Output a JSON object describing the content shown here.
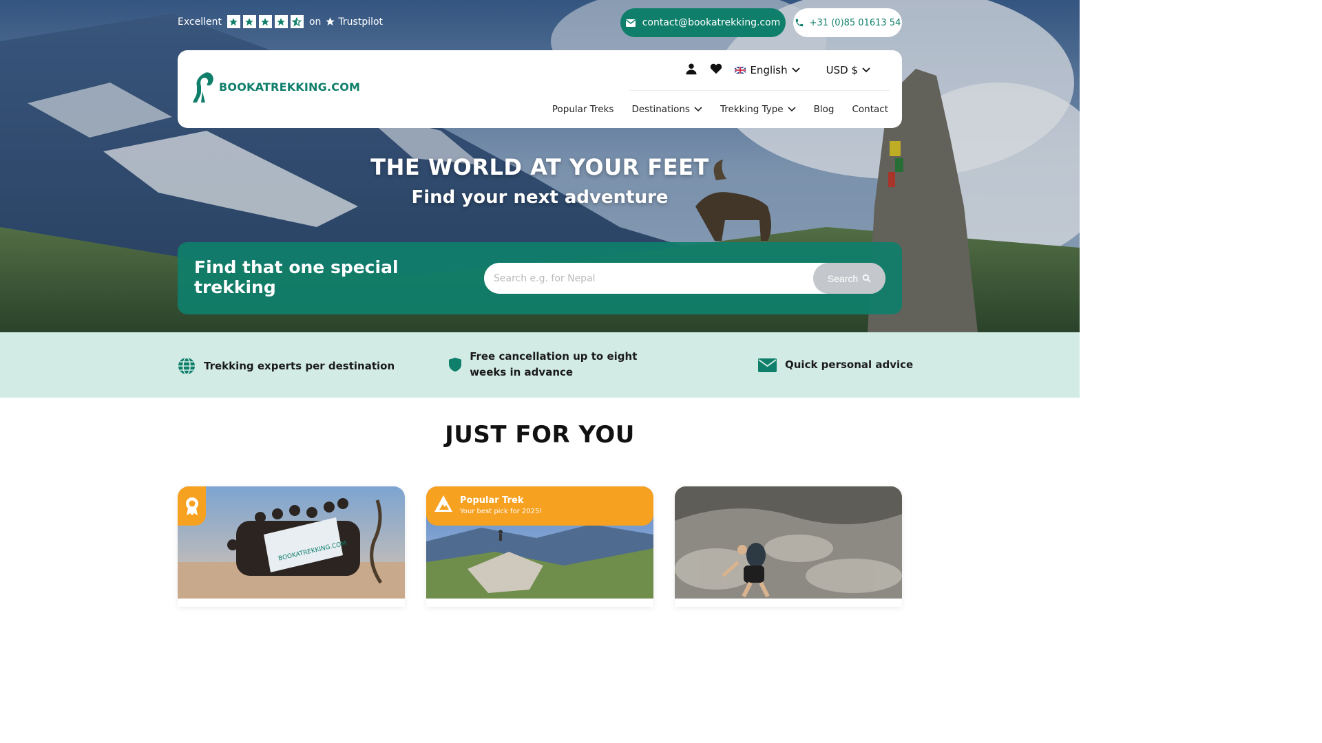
{
  "trustpilot": {
    "rating_word": "Excellent",
    "on": "on",
    "brand": "Trustpilot",
    "stars": 4.5
  },
  "contact": {
    "email": "contact@bookatrekking.com",
    "phone": "+31 (0)85 01613 54"
  },
  "brand": {
    "logo_text": "BOOKATREKKING.COM",
    "color": "#0f7f6b"
  },
  "utility": {
    "language": "English",
    "currency": "USD $"
  },
  "nav": {
    "items": [
      {
        "label": "Popular Treks",
        "dropdown": false
      },
      {
        "label": "Destinations",
        "dropdown": true
      },
      {
        "label": "Trekking Type",
        "dropdown": true
      },
      {
        "label": "Blog",
        "dropdown": false
      },
      {
        "label": "Contact",
        "dropdown": false
      }
    ]
  },
  "hero": {
    "title": "THE WORLD AT YOUR FEET",
    "subtitle": "Find your next adventure"
  },
  "search": {
    "heading": "Find that one special trekking",
    "placeholder": "Search e.g. for Nepal",
    "button": "Search"
  },
  "features": [
    {
      "icon": "globe-icon",
      "text": "Trekking experts per destination"
    },
    {
      "icon": "shield-icon",
      "text": "Free cancellation up to eight weeks in advance"
    },
    {
      "icon": "envelope-icon",
      "text": "Quick personal advice"
    }
  ],
  "section": {
    "title": "JUST FOR YOU"
  },
  "cards": [
    {
      "badge": "award-icon",
      "banner_flag": "BOOKATREKKING.COM"
    },
    {
      "badge_title": "Popular Trek",
      "badge_sub": "Your best pick for 2025!"
    },
    {
      "badge": ""
    }
  ],
  "colors": {
    "accent": "#0f7f6b",
    "orange": "#f7a121",
    "mint": "#d2ece5"
  }
}
